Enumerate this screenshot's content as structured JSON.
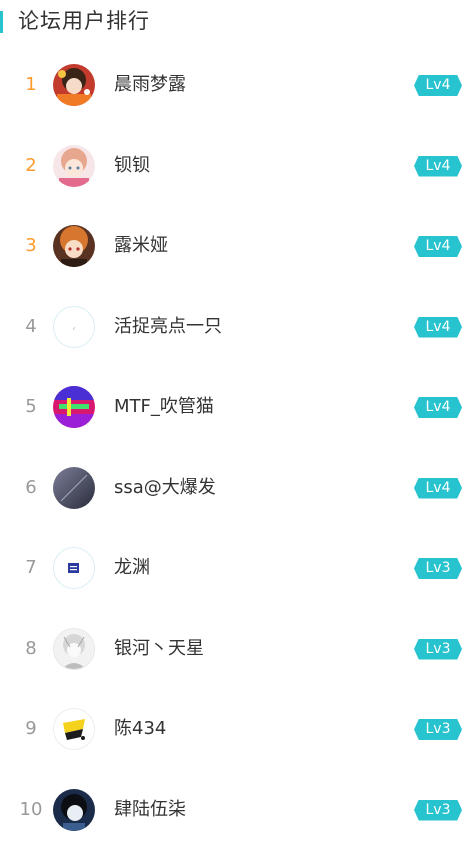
{
  "header": {
    "title": "论坛用户排行"
  },
  "colors": {
    "accent": "#27c3ce",
    "top_rank": "#ff9a2e",
    "rank": "#999999"
  },
  "users": [
    {
      "rank": "1",
      "name": "晨雨梦露",
      "level": "Lv4"
    },
    {
      "rank": "2",
      "name": "钡钡",
      "level": "Lv4"
    },
    {
      "rank": "3",
      "name": "露米娅",
      "level": "Lv4"
    },
    {
      "rank": "4",
      "name": "活捉亮点一只",
      "level": "Lv4"
    },
    {
      "rank": "5",
      "name": "MTF_吹管猫",
      "level": "Lv4"
    },
    {
      "rank": "6",
      "name": "ssa@大爆发",
      "level": "Lv4"
    },
    {
      "rank": "7",
      "name": "龙渊",
      "level": "Lv3"
    },
    {
      "rank": "8",
      "name": "银河丶天星",
      "level": "Lv3"
    },
    {
      "rank": "9",
      "name": "陈434",
      "level": "Lv3"
    },
    {
      "rank": "10",
      "name": "肆陆伍柒",
      "level": "Lv3"
    }
  ]
}
